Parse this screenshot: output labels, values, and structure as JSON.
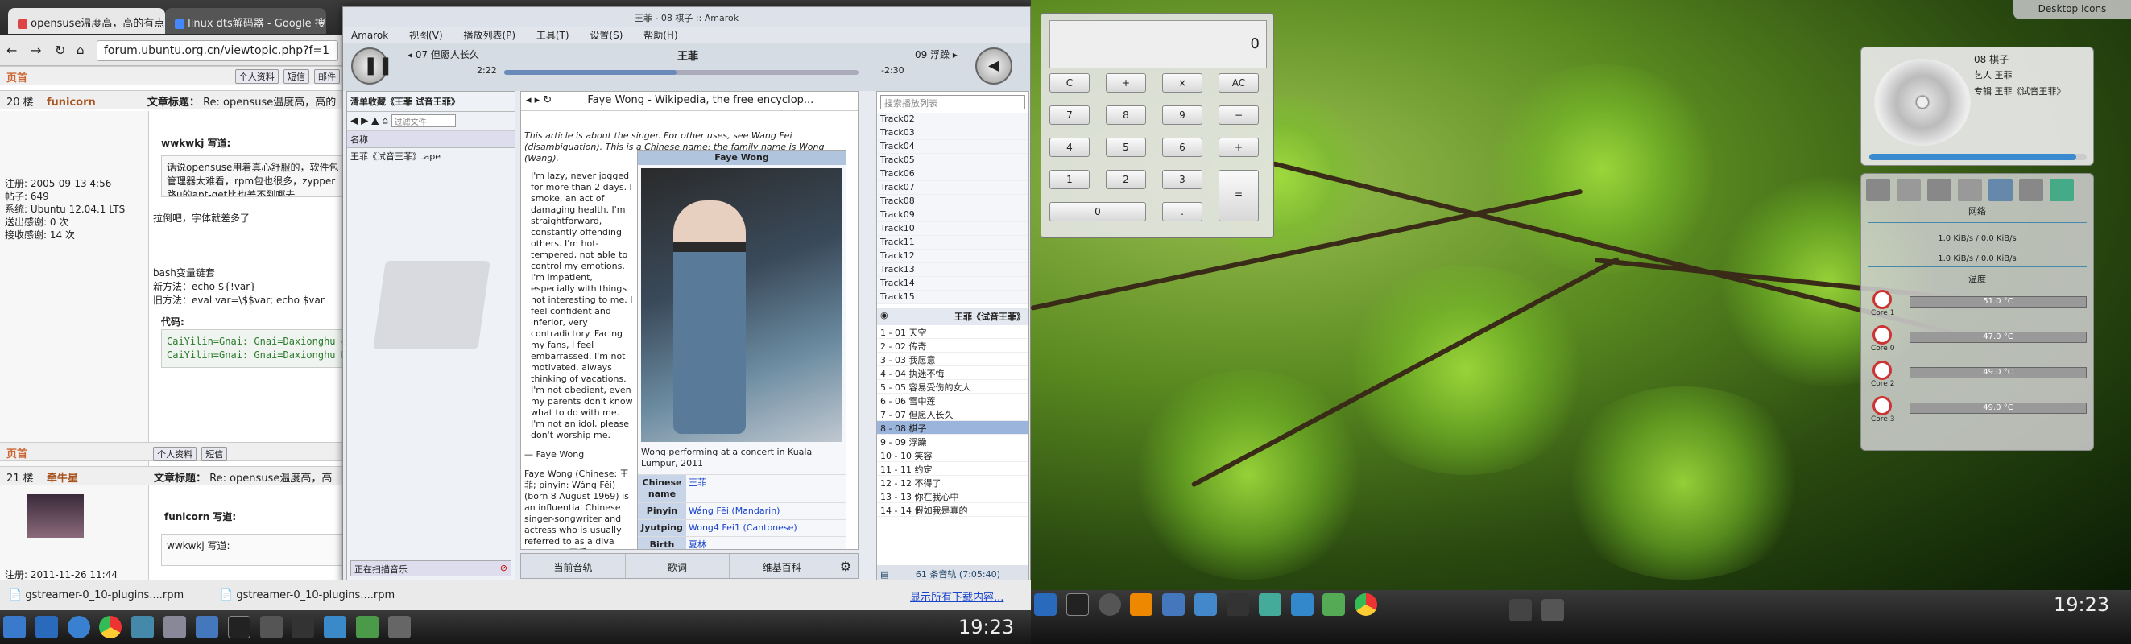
{
  "browser": {
    "tabs": [
      {
        "label": "opensuse温度高，高的有点",
        "active": true
      },
      {
        "label": "linux dts解码器 - Google 搜",
        "active": false
      }
    ],
    "url": "forum.ubuntu.org.cn/viewtopic.php?f=1",
    "post1": {
      "floor": "20 楼",
      "author": "funicorn",
      "subject_label": "文章标题：",
      "subject": "Re: opensuse温度高，高的有点离谱",
      "reg": "注册: 2005-09-13 4:56",
      "posts": "帖子: 649",
      "system": "系统: Ubuntu 12.04.1 LTS",
      "sent": "送出感谢: 0 次",
      "recv": "接收感谢: 14 次",
      "quote_author": "wwkwkj 写道:",
      "quote_text": "话说opensuse用着真心舒服的，软件包管理器太难看，rpm包也很多，zypper路u的apt-get比也差不到哪去。",
      "reply": "拉倒吧，字体就差多了",
      "sig1": "bash变量链套",
      "sig2": "新方法：echo ${!var}",
      "sig3": "旧方法：eval var=\\$$var; echo $var",
      "code_label": "代码:",
      "code1": "CaiYilin=Gnai: Gnai=Daxionghu echo \"CaiYilin=${!CaiYilin}\"",
      "code2": "CaiYilin=Gnai: Gnai=Daxionghu Daxionghu=moqiaishuang"
    },
    "post2": {
      "floor": "21 楼",
      "author": "牵牛星",
      "subject_label": "文章标题：",
      "subject": "Re: opensuse温度高，高的有点离谱",
      "quote_author": "funicorn 写道:",
      "inner_quote": "wwkwkj 写道:",
      "reg": "注册: 2011-11-26 11:44"
    },
    "top_label": "页首",
    "btn_profile": "个人资料",
    "btn_msg": "短信",
    "btn_mail": "邮件"
  },
  "downloads": {
    "item1": "gstreamer-0_10-plugins....rpm",
    "item2": "gstreamer-0_10-plugins....rpm",
    "show_all": "显示所有下载内容..."
  },
  "amarok": {
    "title": "王菲 - 08 棋子 :: Amarok",
    "menu": [
      "Amarok",
      "视图(V)",
      "播放列表(P)",
      "工具(T)",
      "设置(S)",
      "帮助(H)"
    ],
    "prev_track": "07 但愿人长久",
    "artist": "王菲",
    "next_track": "09 浮躁",
    "elapsed": "2:22",
    "remaining": "-2:30",
    "collection_title": "清单收藏《王菲 试音王菲》",
    "filter_placeholder": "过滤文件",
    "col_name": "名称",
    "file": "王菲《试音王菲》.ape",
    "scanning": "正在扫描音乐",
    "wiki_title": "Faye Wong - Wikipedia, the free encyclop...",
    "wiki_hat": "This article is about the singer. For other uses, see Wang Fei (disambiguation). This is a Chinese name; the family name is Wong (Wang).",
    "wiki_quote": "I'm lazy, never jogged for more than 2 days. I smoke, an act of damaging health. I'm straightforward, constantly offending others. I'm hot-tempered, not able to control my emotions. I'm impatient, especially with things not interesting to me. I feel confident and inferior, very contradictory. Facing my fans, I feel embarrassed. I'm not motivated, always thinking of vacations. I'm not obedient, even my parents don't know what to do with me. I'm not an idol, please don't worship me.",
    "wiki_quote_by": "— Faye Wong",
    "wiki_body": "Faye Wong (Chinese: 王菲; pinyin: Wáng Fēi) (born 8 August 1969) is an influential Chinese singer-songwriter and actress who is usually referred to as a diva (Chinese: 天后; literally \"Heavenly Queen\"). Early in her career she briefly used the stage name",
    "infobox_title": "Faye Wong",
    "caption": "Wong performing at a concert in Kuala Lumpur, 2011",
    "info_rows": [
      {
        "k": "Chinese name",
        "v": "王菲"
      },
      {
        "k": "Pinyin",
        "v": "Wáng Fēi (Mandarin)"
      },
      {
        "k": "Jyutping",
        "v": "Wong4 Fei1 (Cantonese)"
      },
      {
        "k": "Birth name",
        "v": "夏林"
      }
    ],
    "tab_current": "当前音轨",
    "tab_lyrics": "歌词",
    "tab_wiki": "维基百科",
    "search_placeholder": "搜索播放列表",
    "playlist_tracks": [
      "Track02",
      "Track03",
      "Track04",
      "Track05",
      "Track06",
      "Track07",
      "Track08",
      "Track09",
      "Track10",
      "Track11",
      "Track12",
      "Track13",
      "Track14",
      "Track15"
    ],
    "album": "王菲《试音王菲》",
    "album_tracks": [
      "1 - 01 天空",
      "2 - 02 传奇",
      "3 - 03 我愿意",
      "4 - 04 执迷不悔",
      "5 - 05 容易受伤的女人",
      "6 - 06 雪中莲",
      "7 - 07 但愿人长久",
      "8 - 08 棋子",
      "9 - 09 浮躁",
      "10 - 10 笑容",
      "11 - 11 约定",
      "12 - 12 不得了",
      "13 - 13 你在我心中",
      "14 - 14 假如我是真的"
    ],
    "status": "61 条音轨 (7:05:40)"
  },
  "calculator": {
    "display": "0",
    "keys": [
      "C",
      "+",
      "×",
      "AC",
      "7",
      "8",
      "9",
      "−",
      "4",
      "5",
      "6",
      "+",
      "1",
      "2",
      "3",
      "=",
      "0",
      "."
    ]
  },
  "now_playing": {
    "title": "08 棋子",
    "artist": "艺人 王菲",
    "album": "专辑 王菲《试音王菲》"
  },
  "sysmon": {
    "net_label": "网络",
    "net1": "1.0 KiB/s / 0.0 KiB/s",
    "net2": "1.0 KiB/s / 0.0 KiB/s",
    "temp_label": "温度",
    "cores": [
      {
        "name": "Core 1",
        "val": "51.0 °C"
      },
      {
        "name": "Core 0",
        "val": "47.0 °C"
      },
      {
        "name": "Core 2",
        "val": "49.0 °C"
      },
      {
        "name": "Core 3",
        "val": "49.0 °C"
      }
    ]
  },
  "desktop_icons": "Desktop Icons",
  "clock_left": "19:23",
  "clock_right": "19:23"
}
